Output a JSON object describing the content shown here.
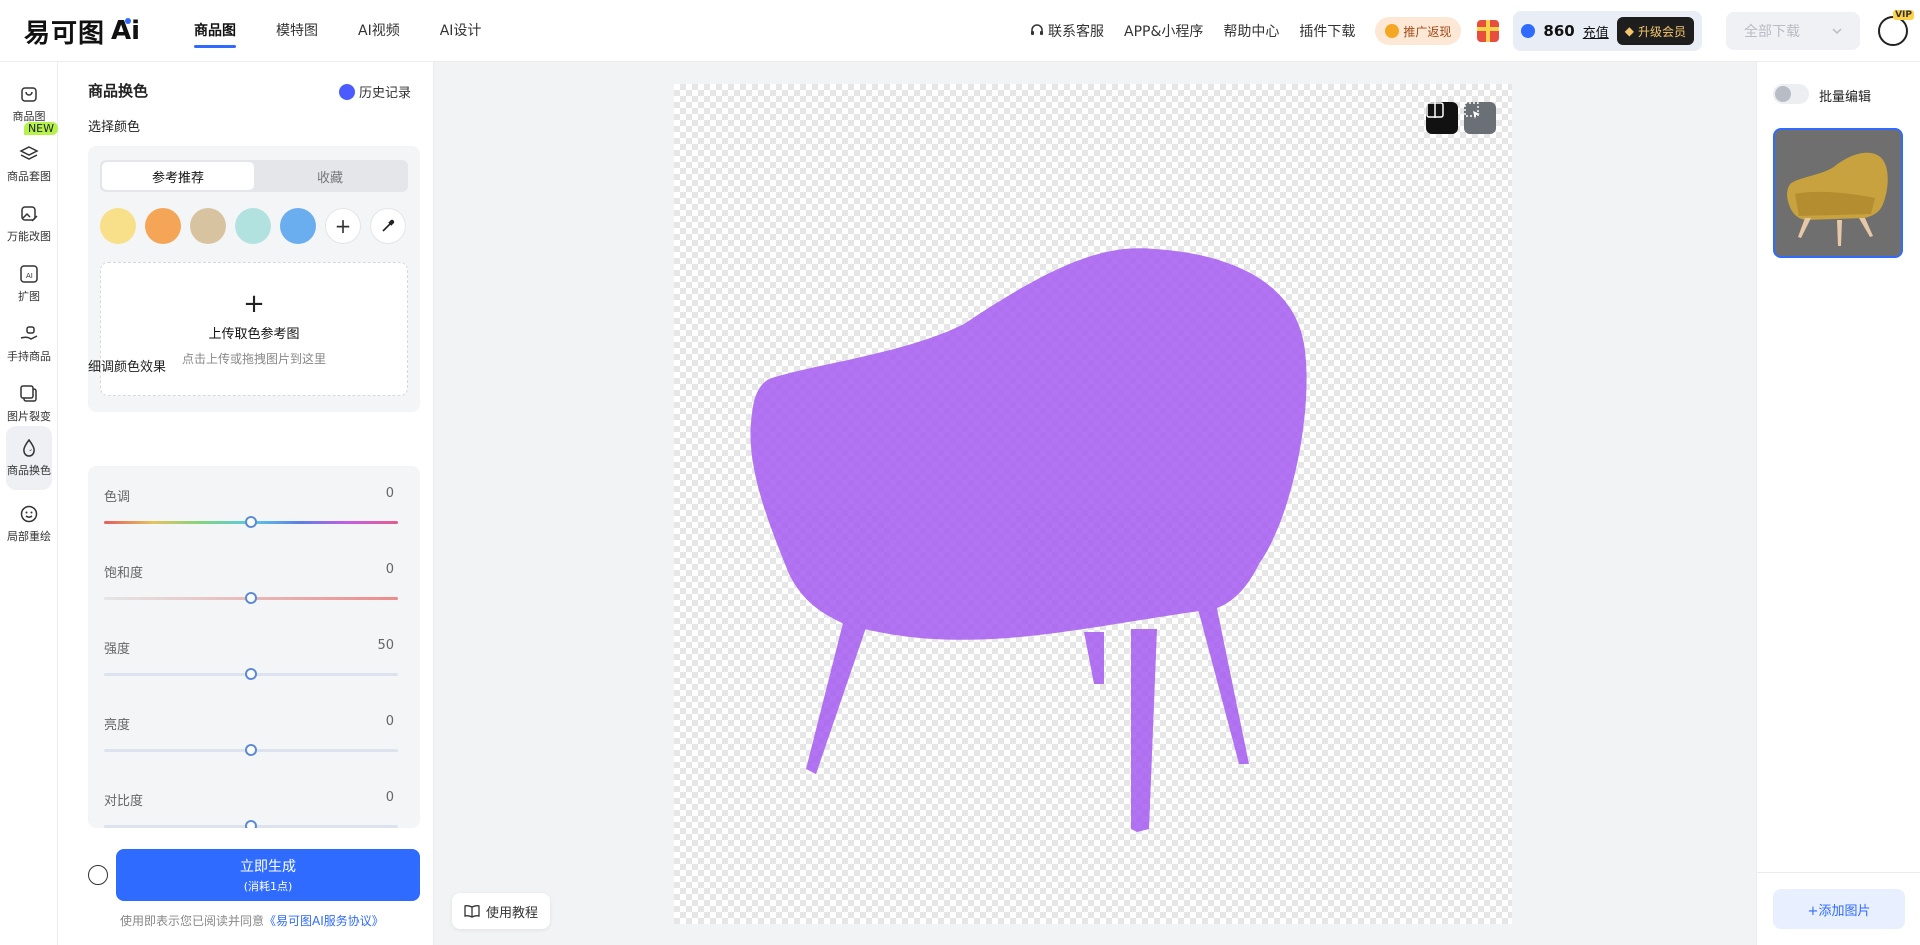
{
  "app": {
    "logo_text": "易可图",
    "logo_ai": "Ai"
  },
  "nav": {
    "tabs": [
      {
        "label": "商品图"
      },
      {
        "label": "模特图"
      },
      {
        "label": "AI视频"
      },
      {
        "label": "AI设计"
      }
    ]
  },
  "header": {
    "service": "联系客服",
    "app": "APP&小程序",
    "help": "帮助中心",
    "plugin": "插件下载",
    "promo": "推广返现",
    "points": "860",
    "recharge": "充值",
    "upgrade": "升级会员",
    "download_all": "全部下载"
  },
  "rail": {
    "items": [
      {
        "label": "商品图"
      },
      {
        "label": "商品套图",
        "badge": "NEW"
      },
      {
        "label": "万能改图"
      },
      {
        "label": "扩图"
      },
      {
        "label": "手持商品"
      },
      {
        "label": "图片裂变"
      },
      {
        "label": "商品换色"
      },
      {
        "label": "局部重绘"
      }
    ]
  },
  "panel": {
    "title": "商品换色",
    "history": "历史记录",
    "choose_color": "选择颜色",
    "tabs": [
      {
        "label": "参考推荐"
      },
      {
        "label": "收藏"
      }
    ],
    "swatches": [
      "#f8df8a",
      "#f5a556",
      "#d7c3a0",
      "#b2e2e0",
      "#6aaef0"
    ],
    "upload_title": "上传取色参考图",
    "upload_hint": "点击上传或拖拽图片到这里",
    "fine_tune": "细调颜色效果",
    "sliders": [
      {
        "label": "色调",
        "value": "0",
        "fraction": 0.5
      },
      {
        "label": "饱和度",
        "value": "0",
        "fraction": 0.5
      },
      {
        "label": "强度",
        "value": "50",
        "fraction": 0.5
      },
      {
        "label": "亮度",
        "value": "0",
        "fraction": 0.5
      },
      {
        "label": "对比度",
        "value": "0",
        "fraction": 0.5
      }
    ],
    "generate_label": "立即生成",
    "generate_cost": "(消耗1点)",
    "agree_text": "使用即表示您已阅读并同意",
    "agree_link": "《易可图AI服务协议》"
  },
  "canvas": {
    "tutorial": "使用教程",
    "mask_color": "#a55cf0"
  },
  "right": {
    "batch_edit": "批量编辑",
    "add_image": "+添加图片"
  }
}
